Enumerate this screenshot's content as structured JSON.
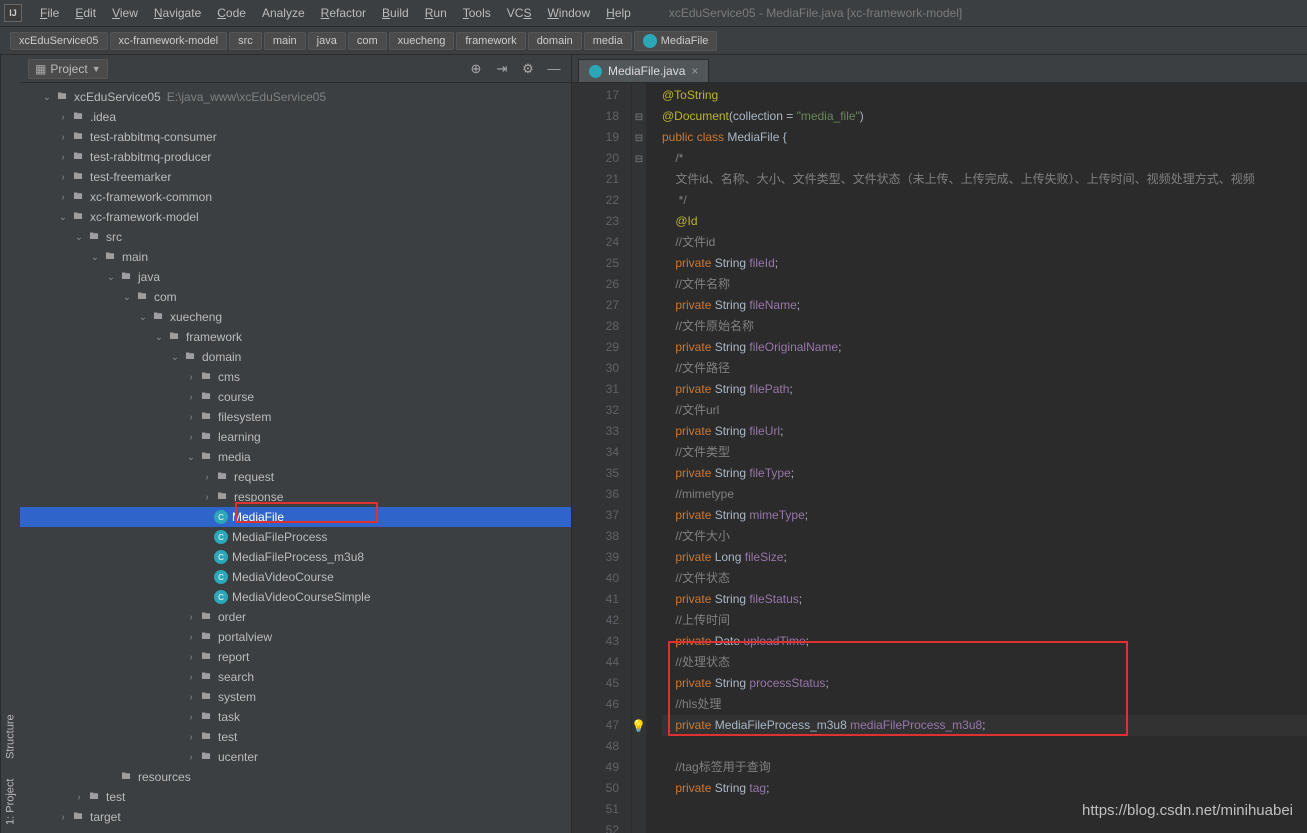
{
  "title": "xcEduService05 - MediaFile.java [xc-framework-model]",
  "menu": [
    "File",
    "Edit",
    "View",
    "Navigate",
    "Code",
    "Analyze",
    "Refactor",
    "Build",
    "Run",
    "Tools",
    "VCS",
    "Window",
    "Help"
  ],
  "menuHotkeys": [
    "F",
    "E",
    "V",
    "N",
    "C",
    "",
    "R",
    "B",
    "R",
    "T",
    "S",
    "W",
    "H"
  ],
  "breadcrumbs": [
    "xcEduService05",
    "xc-framework-model",
    "src",
    "main",
    "java",
    "com",
    "xuecheng",
    "framework",
    "domain",
    "media",
    "MediaFile"
  ],
  "panel": {
    "title": "Project"
  },
  "leftStrip": [
    "1: Project",
    "Structure"
  ],
  "tree": [
    {
      "d": 0,
      "exp": "v",
      "ic": "mod",
      "label": "xcEduService05",
      "path": "E:\\java_www\\xcEduService05"
    },
    {
      "d": 1,
      "exp": ">",
      "ic": "folder",
      "label": ".idea"
    },
    {
      "d": 1,
      "exp": ">",
      "ic": "mod",
      "label": "test-rabbitmq-consumer"
    },
    {
      "d": 1,
      "exp": ">",
      "ic": "mod",
      "label": "test-rabbitmq-producer"
    },
    {
      "d": 1,
      "exp": ">",
      "ic": "mod",
      "label": "test-freemarker"
    },
    {
      "d": 1,
      "exp": ">",
      "ic": "mod",
      "label": "xc-framework-common"
    },
    {
      "d": 1,
      "exp": "v",
      "ic": "mod",
      "label": "xc-framework-model"
    },
    {
      "d": 2,
      "exp": "v",
      "ic": "folder",
      "label": "src"
    },
    {
      "d": 3,
      "exp": "v",
      "ic": "folder",
      "label": "main"
    },
    {
      "d": 4,
      "exp": "v",
      "ic": "folder",
      "label": "java"
    },
    {
      "d": 5,
      "exp": "v",
      "ic": "folder",
      "label": "com"
    },
    {
      "d": 6,
      "exp": "v",
      "ic": "folder",
      "label": "xuecheng"
    },
    {
      "d": 7,
      "exp": "v",
      "ic": "folder",
      "label": "framework"
    },
    {
      "d": 8,
      "exp": "v",
      "ic": "folder",
      "label": "domain"
    },
    {
      "d": 9,
      "exp": ">",
      "ic": "folder",
      "label": "cms"
    },
    {
      "d": 9,
      "exp": ">",
      "ic": "folder",
      "label": "course"
    },
    {
      "d": 9,
      "exp": ">",
      "ic": "folder",
      "label": "filesystem"
    },
    {
      "d": 9,
      "exp": ">",
      "ic": "folder",
      "label": "learning"
    },
    {
      "d": 9,
      "exp": "v",
      "ic": "folder",
      "label": "media"
    },
    {
      "d": 10,
      "exp": ">",
      "ic": "folder",
      "label": "request"
    },
    {
      "d": 10,
      "exp": ">",
      "ic": "folder",
      "label": "response"
    },
    {
      "d": 10,
      "exp": "",
      "ic": "cls",
      "label": "MediaFile",
      "sel": true
    },
    {
      "d": 10,
      "exp": "",
      "ic": "cls",
      "label": "MediaFileProcess"
    },
    {
      "d": 10,
      "exp": "",
      "ic": "cls",
      "label": "MediaFileProcess_m3u8"
    },
    {
      "d": 10,
      "exp": "",
      "ic": "cls",
      "label": "MediaVideoCourse"
    },
    {
      "d": 10,
      "exp": "",
      "ic": "cls",
      "label": "MediaVideoCourseSimple"
    },
    {
      "d": 9,
      "exp": ">",
      "ic": "folder",
      "label": "order"
    },
    {
      "d": 9,
      "exp": ">",
      "ic": "folder",
      "label": "portalview"
    },
    {
      "d": 9,
      "exp": ">",
      "ic": "folder",
      "label": "report"
    },
    {
      "d": 9,
      "exp": ">",
      "ic": "folder",
      "label": "search"
    },
    {
      "d": 9,
      "exp": ">",
      "ic": "folder",
      "label": "system"
    },
    {
      "d": 9,
      "exp": ">",
      "ic": "folder",
      "label": "task"
    },
    {
      "d": 9,
      "exp": ">",
      "ic": "folder",
      "label": "test"
    },
    {
      "d": 9,
      "exp": ">",
      "ic": "folder",
      "label": "ucenter"
    },
    {
      "d": 4,
      "exp": "",
      "ic": "folder",
      "label": "resources"
    },
    {
      "d": 2,
      "exp": ">",
      "ic": "folder",
      "label": "test"
    },
    {
      "d": 1,
      "exp": ">",
      "ic": "folder",
      "label": "target"
    }
  ],
  "tab": {
    "label": "MediaFile.java"
  },
  "lineStart": 17,
  "lineEnd": 52,
  "code": [
    {
      "html": "<span class='ann'>@ToString</span>"
    },
    {
      "html": "<span class='ann'>@Document</span>(collection = <span class='str'>\"media_file\"</span>)"
    },
    {
      "html": "<span class='kw'>public class </span><span class='typ'>MediaFile</span> {"
    },
    {
      "html": "    <span class='cmt'>/*</span>"
    },
    {
      "html": "    <span class='cmt'>文件id、名称、大小、文件类型、文件状态（未上传、上传完成、上传失败）、上传时间、视频处理方式、视频</span>"
    },
    {
      "html": "     <span class='cmt'>*/</span>"
    },
    {
      "html": "    <span class='ann'>@Id</span>"
    },
    {
      "html": "    <span class='cmt'>//文件id</span>"
    },
    {
      "html": "    <span class='kw'>private</span> String <span class='fld'>fileId</span>;"
    },
    {
      "html": "    <span class='cmt'>//文件名称</span>"
    },
    {
      "html": "    <span class='kw'>private</span> String <span class='fld'>fileName</span>;"
    },
    {
      "html": "    <span class='cmt'>//文件原始名称</span>"
    },
    {
      "html": "    <span class='kw'>private</span> String <span class='fld'>fileOriginalName</span>;"
    },
    {
      "html": "    <span class='cmt'>//文件路径</span>"
    },
    {
      "html": "    <span class='kw'>private</span> String <span class='fld'>filePath</span>;"
    },
    {
      "html": "    <span class='cmt'>//文件url</span>"
    },
    {
      "html": "    <span class='kw'>private</span> String <span class='fld'>fileUrl</span>;"
    },
    {
      "html": "    <span class='cmt'>//文件类型</span>"
    },
    {
      "html": "    <span class='kw'>private</span> String <span class='fld'>fileType</span>;"
    },
    {
      "html": "    <span class='cmt'>//mimetype</span>"
    },
    {
      "html": "    <span class='kw'>private</span> String <span class='fld'>mimeType</span>;"
    },
    {
      "html": "    <span class='cmt'>//文件大小</span>"
    },
    {
      "html": "    <span class='kw'>private</span> Long <span class='fld'>fileSize</span>;"
    },
    {
      "html": "    <span class='cmt'>//文件状态</span>"
    },
    {
      "html": "    <span class='kw'>private</span> String <span class='fld'>fileStatus</span>;"
    },
    {
      "html": "    <span class='cmt'>//上传时间</span>"
    },
    {
      "html": "    <span class='kw'>private</span> Date <span class='fld'>uploadTime</span>;"
    },
    {
      "html": "    <span class='cmt'>//处理状态</span>"
    },
    {
      "html": "    <span class='kw'>private</span> String <span class='fld'>processStatus</span>;"
    },
    {
      "html": "    <span class='cmt'>//hls处理</span>"
    },
    {
      "html": "    <span class='kw'>private</span> MediaFileProcess_m3u8 <span class='fld'>mediaFileProcess_m3u8</span>;",
      "cursor": true
    },
    {
      "html": ""
    },
    {
      "html": "    <span class='cmt'>//tag标签用于查询</span>"
    },
    {
      "html": "    <span class='kw'>private</span> String <span class='fld'>tag</span>;"
    },
    {
      "html": ""
    },
    {
      "html": ""
    }
  ],
  "watermark": "https://blog.csdn.net/minihuabei"
}
